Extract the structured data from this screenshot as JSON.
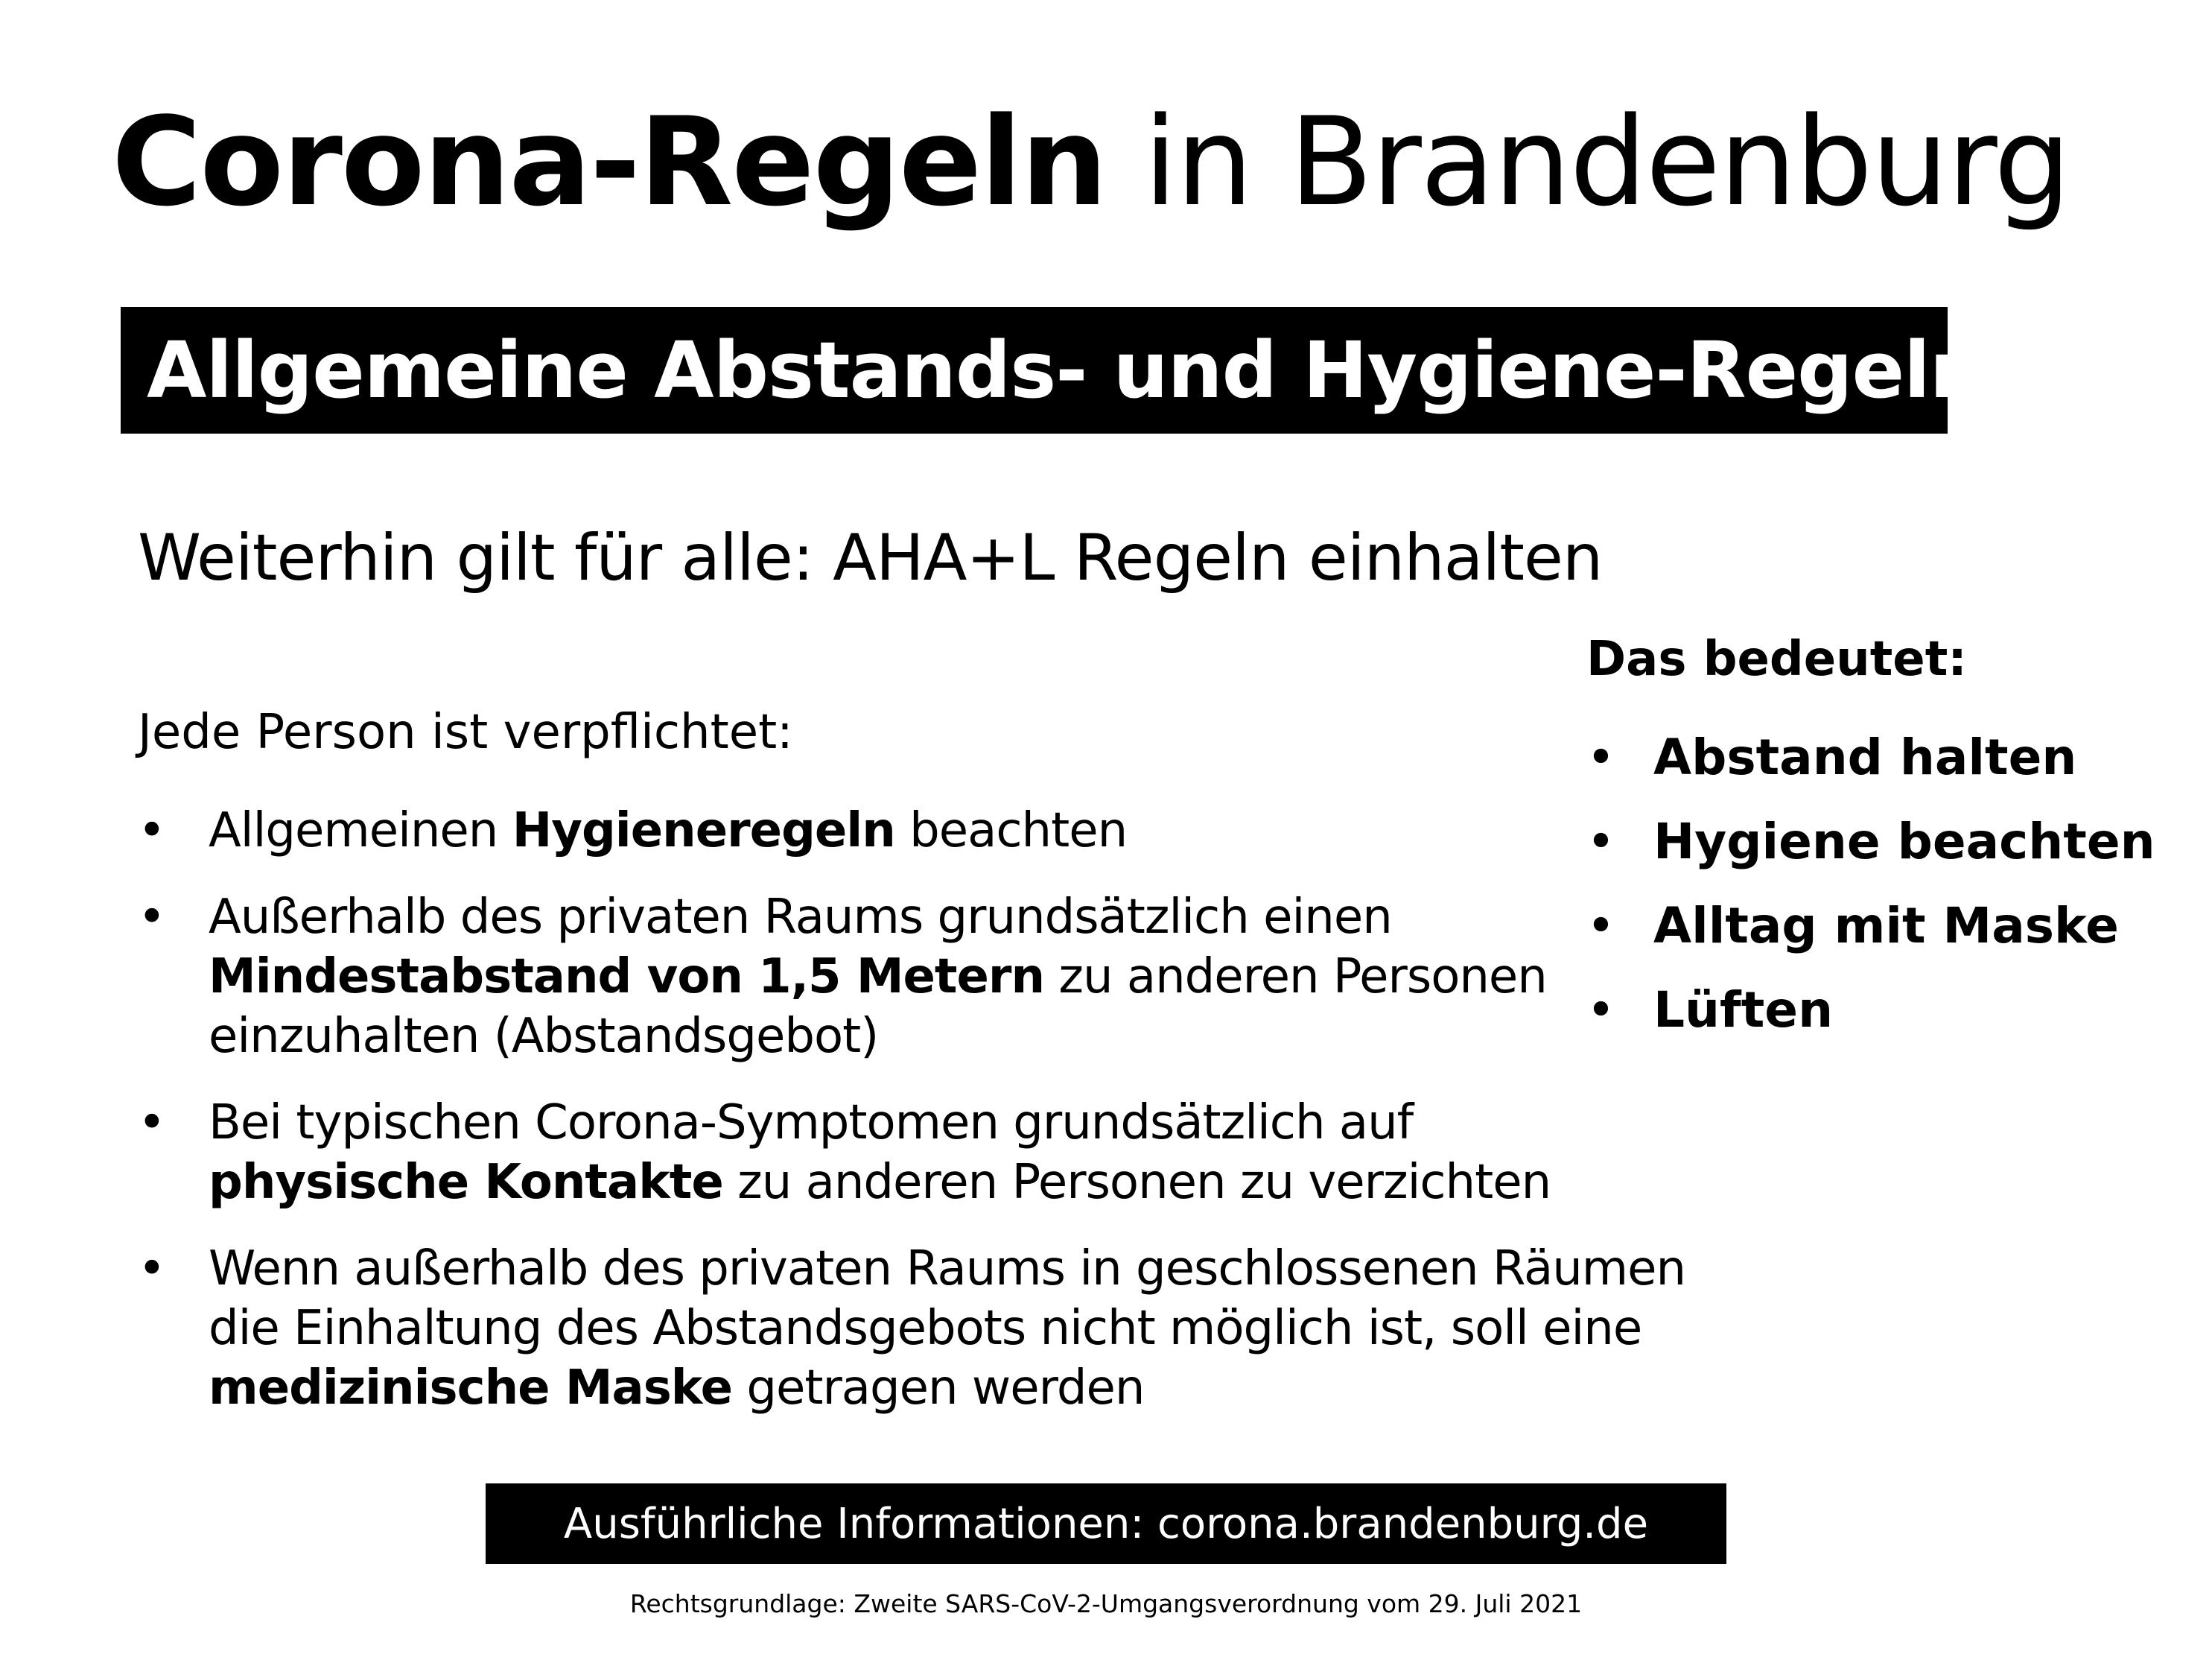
{
  "title": {
    "bold": "Corona-Regeln",
    "rest": " in Brandenburg"
  },
  "banner": "Allgemeine Abstands- und Hygiene-Regeln",
  "subtitle": "Weiterhin gilt für alle: AHA+L Regeln einhalten",
  "lead": "Jede Person ist verpflichtet:",
  "bullet_char": "•",
  "rules": [
    {
      "a": "Allgemeinen ",
      "b": "Hygieneregeln",
      "c": " beachten"
    },
    {
      "a": "Außerhalb des privaten Raums grundsätzlich einen ",
      "b": "Mindestabstand von 1,5 Metern",
      "c": " zu anderen Personen einzuhalten (Abstandsgebot)"
    },
    {
      "a": "Bei typischen Corona-Symptomen grundsätzlich auf ",
      "b": "physische Kontakte",
      "c": " zu anderen Personen zu verzichten"
    },
    {
      "a": "Wenn außerhalb des privaten Raums in geschlossenen Räumen die Einhaltung des Abstandsgebots nicht möglich ist, soll eine ",
      "b": "medizinische Maske",
      "c": " getragen werden"
    }
  ],
  "means": {
    "title": "Das bedeutet:",
    "items": [
      "Abstand halten",
      "Hygiene beachten",
      "Alltag mit Maske",
      "Lüften"
    ]
  },
  "info": "Ausführliche Informationen: corona.brandenburg.de",
  "legal": "Rechtsgrundlage: Zweite SARS-CoV-2-Umgangsverordnung vom 29. Juli 2021"
}
